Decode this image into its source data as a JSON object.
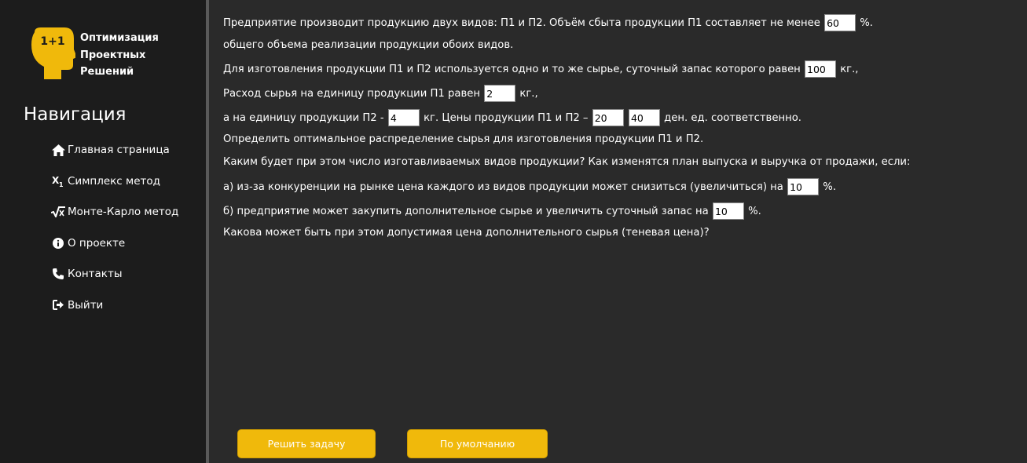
{
  "brand": {
    "logo_text": "1+1",
    "name_line1": "Оптимизация",
    "name_line2": "Проектных",
    "name_line3": "Решений",
    "accent_color": "#f0b90b"
  },
  "sidebar": {
    "title": "Навигация",
    "items": [
      {
        "label": "Главная страница",
        "icon": "home-icon"
      },
      {
        "label": "Симплекс метод",
        "icon": "subscript-x-icon"
      },
      {
        "label": "Монте-Карло метод",
        "icon": "square-root-icon"
      },
      {
        "label": "О проекте",
        "icon": "info-circle-icon"
      },
      {
        "label": "Контакты",
        "icon": "phone-icon"
      },
      {
        "label": "Выйти",
        "icon": "sign-out-icon"
      }
    ]
  },
  "problem": {
    "l1_a": "Предприятие производит продукцию двух видов: П1 и П2. Объём сбыта продукции П1 составляет не менее",
    "l1_b": "%.",
    "share_p1_percent": "60",
    "l2": "общего объема реализации продукции обоих видов.",
    "l3_a": "Для изготовления продукции П1 и П2 используется одно и то же сырье, суточный запас которого равен",
    "l3_b": "кг.,",
    "daily_stock": "100",
    "l4_a": "Расход сырья на единицу продукции П1 равен",
    "l4_b": "кг.,",
    "usage_p1": "2",
    "l5_a": "а на единицу продукции П2 -",
    "l5_b": "кг. Цены продукции П1 и П2 –",
    "l5_c": "ден. ед. соответственно.",
    "usage_p2": "4",
    "price_p1": "20",
    "price_p2": "40",
    "l6": "Определить оптимальное распределение сырья для изготовления продукции П1 и П2.",
    "l7": "Каким будет при этом число изготавливаемых видов продукции? Как изменятся план выпуска и выручка от продажи, если:",
    "l8_a": "а) из-за конкуренции на рынке цена каждого из видов продукции может снизиться (увеличиться) на",
    "l8_b": "%.",
    "price_change_percent": "10",
    "l9_a": "б) предприятие может закупить дополнительное сырье и увеличить суточный запас на",
    "l9_b": "%.",
    "stock_increase_percent": "10",
    "l10": "Какова может быть при этом допустимая цена дополнительного сырья (теневая цена)?"
  },
  "buttons": {
    "solve": "Решить задачу",
    "defaults": "По умолчанию"
  }
}
